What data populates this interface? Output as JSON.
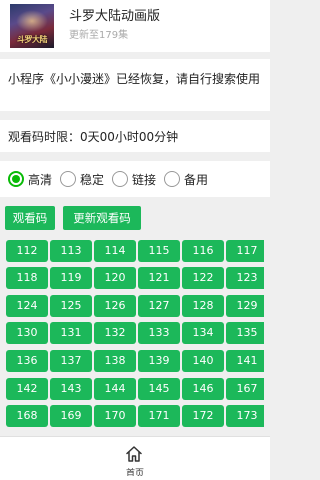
{
  "header": {
    "title": "斗罗大陆动画版",
    "subtitle": "更新至179集",
    "thumbnail_text": "斗罗大陆"
  },
  "notice": {
    "text": "小程序《小小漫迷》已经恢复，请自行搜索使用"
  },
  "timer": {
    "text": "观看码时限：0天00小时00分钟"
  },
  "quality_options": [
    {
      "label": "高清",
      "checked": true
    },
    {
      "label": "稳定",
      "checked": false
    },
    {
      "label": "链接",
      "checked": false
    },
    {
      "label": "备用",
      "checked": false
    }
  ],
  "actions": {
    "watch_code_label": "观看码",
    "update_code_label": "更新观看码"
  },
  "episodes": [
    "112",
    "113",
    "114",
    "115",
    "116",
    "117",
    "118",
    "119",
    "120",
    "121",
    "122",
    "123",
    "124",
    "125",
    "126",
    "127",
    "128",
    "129",
    "130",
    "131",
    "132",
    "133",
    "134",
    "135",
    "136",
    "137",
    "138",
    "139",
    "140",
    "141",
    "142",
    "143",
    "144",
    "145",
    "146",
    "167",
    "168",
    "169",
    "170",
    "171",
    "172",
    "173"
  ],
  "tabbar": {
    "home_label": "首页"
  },
  "colors": {
    "accent": "#1cb85a",
    "radio_accent": "#09bb07",
    "background": "#efefef"
  }
}
